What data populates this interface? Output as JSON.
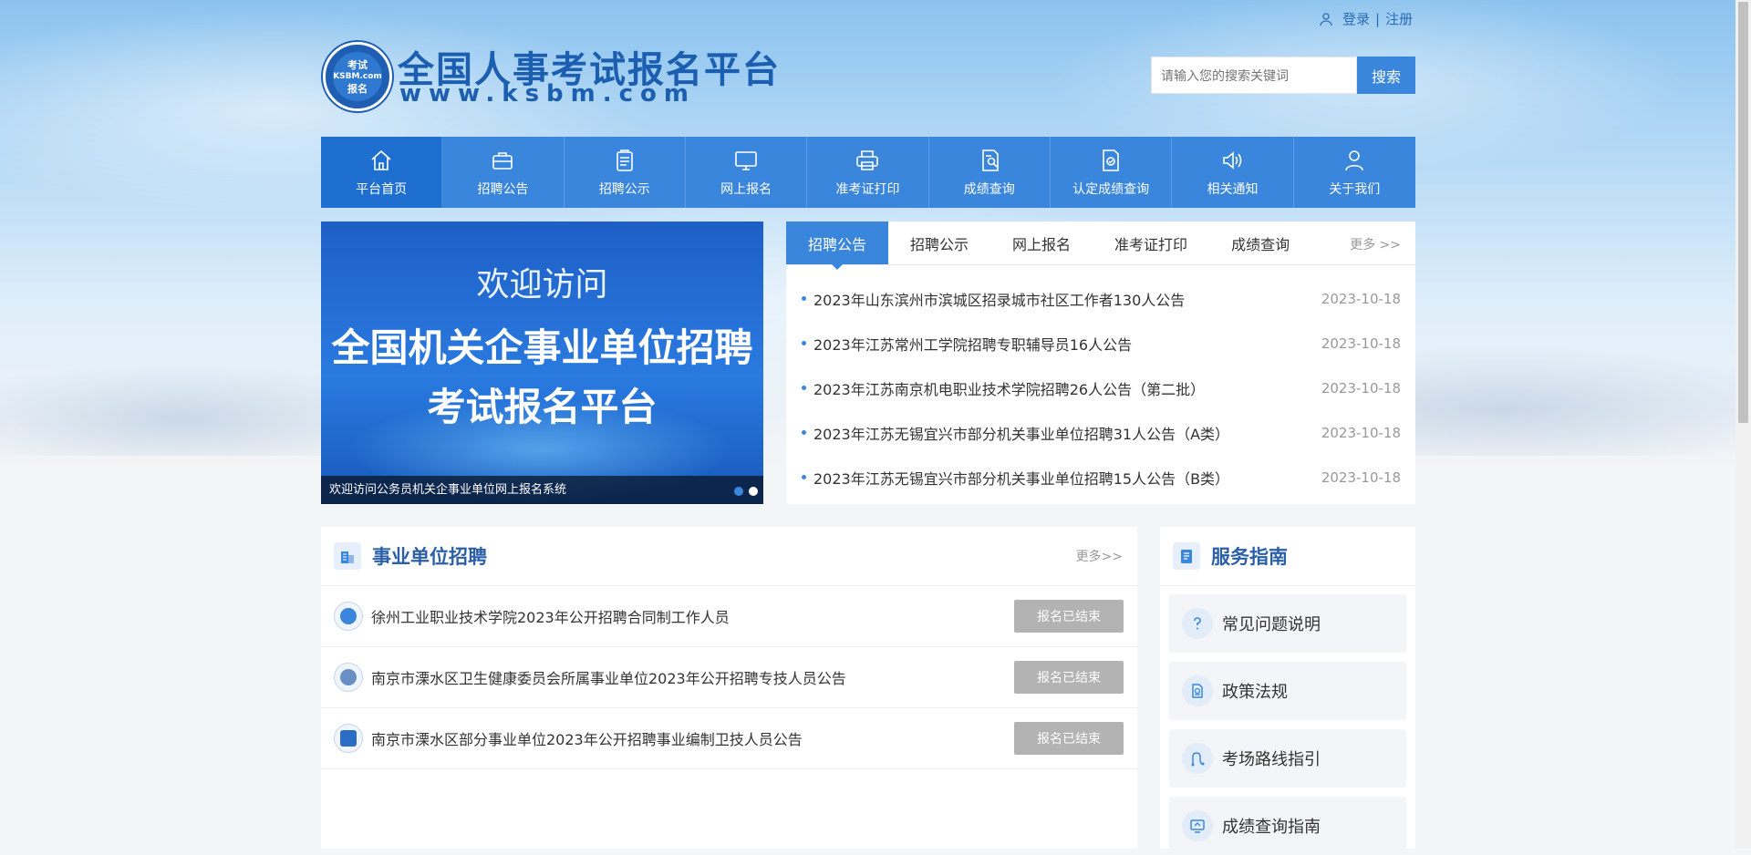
{
  "header": {
    "login": "登录",
    "separator": "|",
    "register": "注册",
    "logo_title": "全国人事考试报名平台",
    "logo_url": "www.ksbm.com",
    "logo_seal_top": "考试",
    "logo_seal_mid": "KSBM.com",
    "logo_seal_bottom": "报名",
    "search_placeholder": "请输入您的搜索关键词",
    "search_button": "搜索"
  },
  "nav": {
    "items": [
      {
        "label": "平台首页",
        "icon": "home-icon"
      },
      {
        "label": "招聘公告",
        "icon": "briefcase-icon"
      },
      {
        "label": "招聘公示",
        "icon": "clipboard-icon"
      },
      {
        "label": "网上报名",
        "icon": "monitor-icon"
      },
      {
        "label": "准考证打印",
        "icon": "printer-icon"
      },
      {
        "label": "成绩查询",
        "icon": "search-document-icon"
      },
      {
        "label": "认定成绩查询",
        "icon": "certified-document-icon"
      },
      {
        "label": "相关通知",
        "icon": "speaker-icon"
      },
      {
        "label": "关于我们",
        "icon": "user-icon"
      }
    ],
    "active_index": 0
  },
  "banner": {
    "welcome": "欢迎访问",
    "line1": "全国机关企事业单位招聘",
    "line2": "考试报名平台",
    "caption": "欢迎访问公务员机关企事业单位网上报名系统"
  },
  "news": {
    "tabs": [
      "招聘公告",
      "招聘公示",
      "网上报名",
      "准考证打印",
      "成绩查询"
    ],
    "more": "更多 >>",
    "items": [
      {
        "title": "2023年山东滨州市滨城区招录城市社区工作者130人公告",
        "date": "2023-10-18"
      },
      {
        "title": "2023年江苏常州工学院招聘专职辅导员16人公告",
        "date": "2023-10-18"
      },
      {
        "title": "2023年江苏南京机电职业技术学院招聘26人公告（第二批）",
        "date": "2023-10-18"
      },
      {
        "title": "2023年江苏无锡宜兴市部分机关事业单位招聘31人公告（A类）",
        "date": "2023-10-18"
      },
      {
        "title": "2023年江苏无锡宜兴市部分机关事业单位招聘15人公告（B类）",
        "date": "2023-10-18"
      }
    ]
  },
  "recruit": {
    "title": "事业单位招聘",
    "more": "更多>>",
    "rows": [
      {
        "name": "徐州工业职业技术学院2023年公开招聘合同制工作人员",
        "status": "报名已结束"
      },
      {
        "name": "南京市溧水区卫生健康委员会所属事业单位2023年公开招聘专技人员公告",
        "status": "报名已结束"
      },
      {
        "name": "南京市溧水区部分事业单位2023年公开招聘事业编制卫技人员公告",
        "status": "报名已结束"
      }
    ]
  },
  "guide": {
    "title": "服务指南",
    "items": [
      {
        "label": "常见问题说明",
        "icon": "question-icon"
      },
      {
        "label": "政策法规",
        "icon": "policy-document-icon"
      },
      {
        "label": "考场路线指引",
        "icon": "route-icon"
      },
      {
        "label": "成绩查询指南",
        "icon": "score-screen-icon"
      }
    ]
  },
  "colors": {
    "primary": "#3a86dd",
    "nav_active": "#1f6fd1",
    "title_blue": "#2b5fa8",
    "status_gray": "#b3b3b3"
  }
}
